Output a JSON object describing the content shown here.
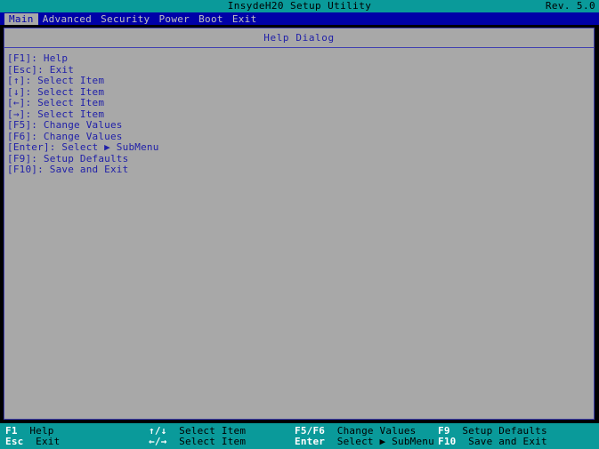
{
  "window": {
    "title": "InsydeH20 Setup Utility",
    "revision": "Rev. 5.0"
  },
  "menu": {
    "items": [
      {
        "label": "Main",
        "active": true
      },
      {
        "label": "Advanced",
        "active": false
      },
      {
        "label": "Security",
        "active": false
      },
      {
        "label": "Power",
        "active": false
      },
      {
        "label": "Boot",
        "active": false
      },
      {
        "label": "Exit",
        "active": false
      }
    ]
  },
  "dialog": {
    "title": "Help Dialog",
    "lines": [
      "[F1]: Help",
      "[Esc]: Exit",
      "[↑]: Select Item",
      "[↓]: Select Item",
      "[←]: Select Item",
      "[→]: Select Item",
      "[F5]: Change Values",
      "[F6]: Change Values",
      "[Enter]: Select ▶ SubMenu",
      "[F9]: Setup Defaults",
      "[F10]: Save and Exit"
    ]
  },
  "status_bar": {
    "cells": [
      {
        "key": "F1",
        "desc": "Help",
        "col": 0,
        "row": 0
      },
      {
        "key": "Esc",
        "desc": "Exit",
        "col": 0,
        "row": 1
      },
      {
        "key": "↑/↓",
        "desc": "Select Item",
        "col": 1,
        "row": 0
      },
      {
        "key": "←/→",
        "desc": "Select Item",
        "col": 1,
        "row": 1
      },
      {
        "key": "F5/F6",
        "desc": "Change Values",
        "col": 2,
        "row": 0
      },
      {
        "key": "Enter",
        "desc": "Select ▶ SubMenu",
        "col": 2,
        "row": 1
      },
      {
        "key": "F9",
        "desc": "Setup Defaults",
        "col": 3,
        "row": 0
      },
      {
        "key": "F10",
        "desc": "Save and Exit",
        "col": 3,
        "row": 1
      }
    ]
  },
  "colors": {
    "title_bar_bg": "#0a9a9a",
    "menu_bar_bg": "#0000a8",
    "panel_bg": "#a8a8a8",
    "panel_border": "#4040b0",
    "text_blue": "#2020a8",
    "menu_text": "#c0c0c0",
    "status_key": "#ffffff",
    "screen_bg": "#000000"
  }
}
